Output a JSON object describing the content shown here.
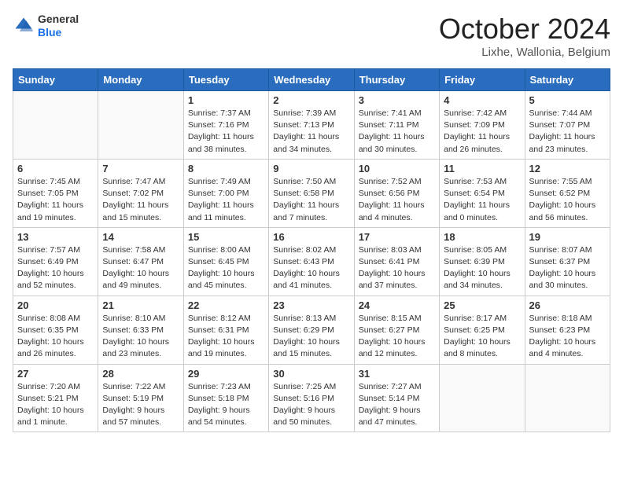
{
  "logo": {
    "general": "General",
    "blue": "Blue"
  },
  "header": {
    "month": "October 2024",
    "location": "Lixhe, Wallonia, Belgium"
  },
  "days_of_week": [
    "Sunday",
    "Monday",
    "Tuesday",
    "Wednesday",
    "Thursday",
    "Friday",
    "Saturday"
  ],
  "weeks": [
    [
      {
        "day": "",
        "sunrise": "",
        "sunset": "",
        "daylight": "",
        "empty": true
      },
      {
        "day": "",
        "sunrise": "",
        "sunset": "",
        "daylight": "",
        "empty": true
      },
      {
        "day": "1",
        "sunrise": "Sunrise: 7:37 AM",
        "sunset": "Sunset: 7:16 PM",
        "daylight": "Daylight: 11 hours and 38 minutes."
      },
      {
        "day": "2",
        "sunrise": "Sunrise: 7:39 AM",
        "sunset": "Sunset: 7:13 PM",
        "daylight": "Daylight: 11 hours and 34 minutes."
      },
      {
        "day": "3",
        "sunrise": "Sunrise: 7:41 AM",
        "sunset": "Sunset: 7:11 PM",
        "daylight": "Daylight: 11 hours and 30 minutes."
      },
      {
        "day": "4",
        "sunrise": "Sunrise: 7:42 AM",
        "sunset": "Sunset: 7:09 PM",
        "daylight": "Daylight: 11 hours and 26 minutes."
      },
      {
        "day": "5",
        "sunrise": "Sunrise: 7:44 AM",
        "sunset": "Sunset: 7:07 PM",
        "daylight": "Daylight: 11 hours and 23 minutes."
      }
    ],
    [
      {
        "day": "6",
        "sunrise": "Sunrise: 7:45 AM",
        "sunset": "Sunset: 7:05 PM",
        "daylight": "Daylight: 11 hours and 19 minutes."
      },
      {
        "day": "7",
        "sunrise": "Sunrise: 7:47 AM",
        "sunset": "Sunset: 7:02 PM",
        "daylight": "Daylight: 11 hours and 15 minutes."
      },
      {
        "day": "8",
        "sunrise": "Sunrise: 7:49 AM",
        "sunset": "Sunset: 7:00 PM",
        "daylight": "Daylight: 11 hours and 11 minutes."
      },
      {
        "day": "9",
        "sunrise": "Sunrise: 7:50 AM",
        "sunset": "Sunset: 6:58 PM",
        "daylight": "Daylight: 11 hours and 7 minutes."
      },
      {
        "day": "10",
        "sunrise": "Sunrise: 7:52 AM",
        "sunset": "Sunset: 6:56 PM",
        "daylight": "Daylight: 11 hours and 4 minutes."
      },
      {
        "day": "11",
        "sunrise": "Sunrise: 7:53 AM",
        "sunset": "Sunset: 6:54 PM",
        "daylight": "Daylight: 11 hours and 0 minutes."
      },
      {
        "day": "12",
        "sunrise": "Sunrise: 7:55 AM",
        "sunset": "Sunset: 6:52 PM",
        "daylight": "Daylight: 10 hours and 56 minutes."
      }
    ],
    [
      {
        "day": "13",
        "sunrise": "Sunrise: 7:57 AM",
        "sunset": "Sunset: 6:49 PM",
        "daylight": "Daylight: 10 hours and 52 minutes."
      },
      {
        "day": "14",
        "sunrise": "Sunrise: 7:58 AM",
        "sunset": "Sunset: 6:47 PM",
        "daylight": "Daylight: 10 hours and 49 minutes."
      },
      {
        "day": "15",
        "sunrise": "Sunrise: 8:00 AM",
        "sunset": "Sunset: 6:45 PM",
        "daylight": "Daylight: 10 hours and 45 minutes."
      },
      {
        "day": "16",
        "sunrise": "Sunrise: 8:02 AM",
        "sunset": "Sunset: 6:43 PM",
        "daylight": "Daylight: 10 hours and 41 minutes."
      },
      {
        "day": "17",
        "sunrise": "Sunrise: 8:03 AM",
        "sunset": "Sunset: 6:41 PM",
        "daylight": "Daylight: 10 hours and 37 minutes."
      },
      {
        "day": "18",
        "sunrise": "Sunrise: 8:05 AM",
        "sunset": "Sunset: 6:39 PM",
        "daylight": "Daylight: 10 hours and 34 minutes."
      },
      {
        "day": "19",
        "sunrise": "Sunrise: 8:07 AM",
        "sunset": "Sunset: 6:37 PM",
        "daylight": "Daylight: 10 hours and 30 minutes."
      }
    ],
    [
      {
        "day": "20",
        "sunrise": "Sunrise: 8:08 AM",
        "sunset": "Sunset: 6:35 PM",
        "daylight": "Daylight: 10 hours and 26 minutes."
      },
      {
        "day": "21",
        "sunrise": "Sunrise: 8:10 AM",
        "sunset": "Sunset: 6:33 PM",
        "daylight": "Daylight: 10 hours and 23 minutes."
      },
      {
        "day": "22",
        "sunrise": "Sunrise: 8:12 AM",
        "sunset": "Sunset: 6:31 PM",
        "daylight": "Daylight: 10 hours and 19 minutes."
      },
      {
        "day": "23",
        "sunrise": "Sunrise: 8:13 AM",
        "sunset": "Sunset: 6:29 PM",
        "daylight": "Daylight: 10 hours and 15 minutes."
      },
      {
        "day": "24",
        "sunrise": "Sunrise: 8:15 AM",
        "sunset": "Sunset: 6:27 PM",
        "daylight": "Daylight: 10 hours and 12 minutes."
      },
      {
        "day": "25",
        "sunrise": "Sunrise: 8:17 AM",
        "sunset": "Sunset: 6:25 PM",
        "daylight": "Daylight: 10 hours and 8 minutes."
      },
      {
        "day": "26",
        "sunrise": "Sunrise: 8:18 AM",
        "sunset": "Sunset: 6:23 PM",
        "daylight": "Daylight: 10 hours and 4 minutes."
      }
    ],
    [
      {
        "day": "27",
        "sunrise": "Sunrise: 7:20 AM",
        "sunset": "Sunset: 5:21 PM",
        "daylight": "Daylight: 10 hours and 1 minute."
      },
      {
        "day": "28",
        "sunrise": "Sunrise: 7:22 AM",
        "sunset": "Sunset: 5:19 PM",
        "daylight": "Daylight: 9 hours and 57 minutes."
      },
      {
        "day": "29",
        "sunrise": "Sunrise: 7:23 AM",
        "sunset": "Sunset: 5:18 PM",
        "daylight": "Daylight: 9 hours and 54 minutes."
      },
      {
        "day": "30",
        "sunrise": "Sunrise: 7:25 AM",
        "sunset": "Sunset: 5:16 PM",
        "daylight": "Daylight: 9 hours and 50 minutes."
      },
      {
        "day": "31",
        "sunrise": "Sunrise: 7:27 AM",
        "sunset": "Sunset: 5:14 PM",
        "daylight": "Daylight: 9 hours and 47 minutes."
      },
      {
        "day": "",
        "sunrise": "",
        "sunset": "",
        "daylight": "",
        "empty": true
      },
      {
        "day": "",
        "sunrise": "",
        "sunset": "",
        "daylight": "",
        "empty": true
      }
    ]
  ]
}
